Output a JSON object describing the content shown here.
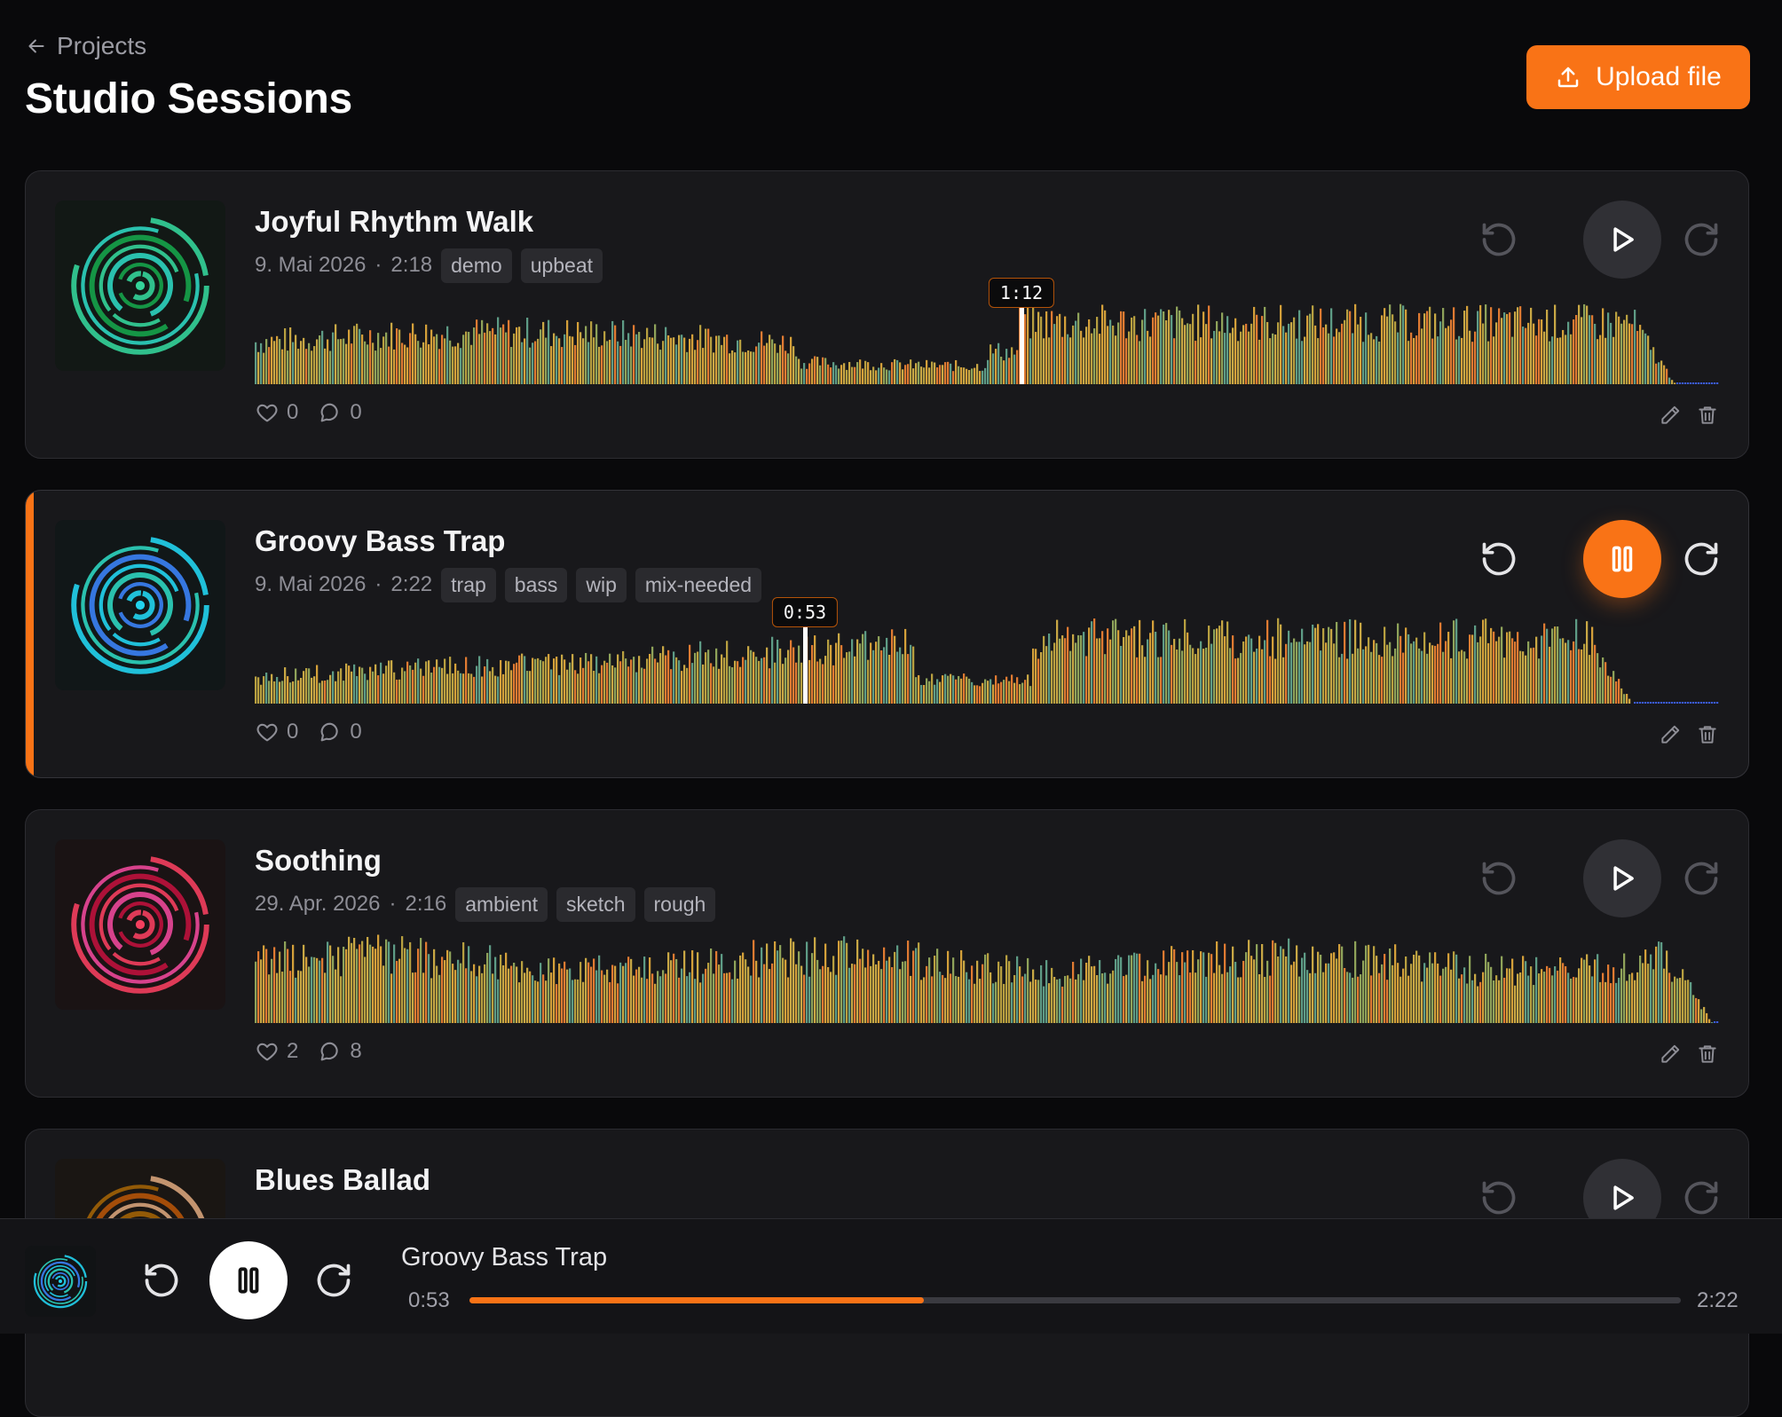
{
  "header": {
    "back_label": "Projects",
    "title": "Studio Sessions",
    "upload_label": "Upload file"
  },
  "colors": {
    "accent": "#f97316",
    "background": "#09090b",
    "card": "#18181b"
  },
  "tracks": [
    {
      "title": "Joyful Rhythm Walk",
      "date": "9. Mai 2026",
      "sep": "·",
      "duration": "2:18",
      "tags": [
        "demo",
        "upbeat"
      ],
      "likes": "0",
      "comments": "0",
      "hover_time": "1:12",
      "hover_fraction": 0.522,
      "playing": false,
      "art_colors": [
        "#34d399",
        "#2dd4bf",
        "#16a34a"
      ]
    },
    {
      "title": "Groovy Bass Trap",
      "date": "9. Mai 2026",
      "sep": "·",
      "duration": "2:22",
      "tags": [
        "trap",
        "bass",
        "wip",
        "mix-needed"
      ],
      "likes": "0",
      "comments": "0",
      "hover_time": "0:53",
      "hover_fraction": 0.376,
      "playing": true,
      "art_colors": [
        "#22d3ee",
        "#2dd4bf",
        "#3b82f6"
      ]
    },
    {
      "title": "Soothing",
      "date": "29. Apr. 2026",
      "sep": "·",
      "duration": "2:16",
      "tags": [
        "ambient",
        "sketch",
        "rough"
      ],
      "likes": "2",
      "comments": "8",
      "playing": false,
      "art_colors": [
        "#f43f5e",
        "#ec4899",
        "#be123c"
      ]
    },
    {
      "title": "Blues Ballad",
      "playing": false,
      "art_colors": [
        "#d6a27a",
        "#a16207",
        "#b45309"
      ]
    }
  ],
  "player": {
    "title": "Groovy Bass Trap",
    "current": "0:53",
    "total": "2:22",
    "progress": 0.375
  }
}
